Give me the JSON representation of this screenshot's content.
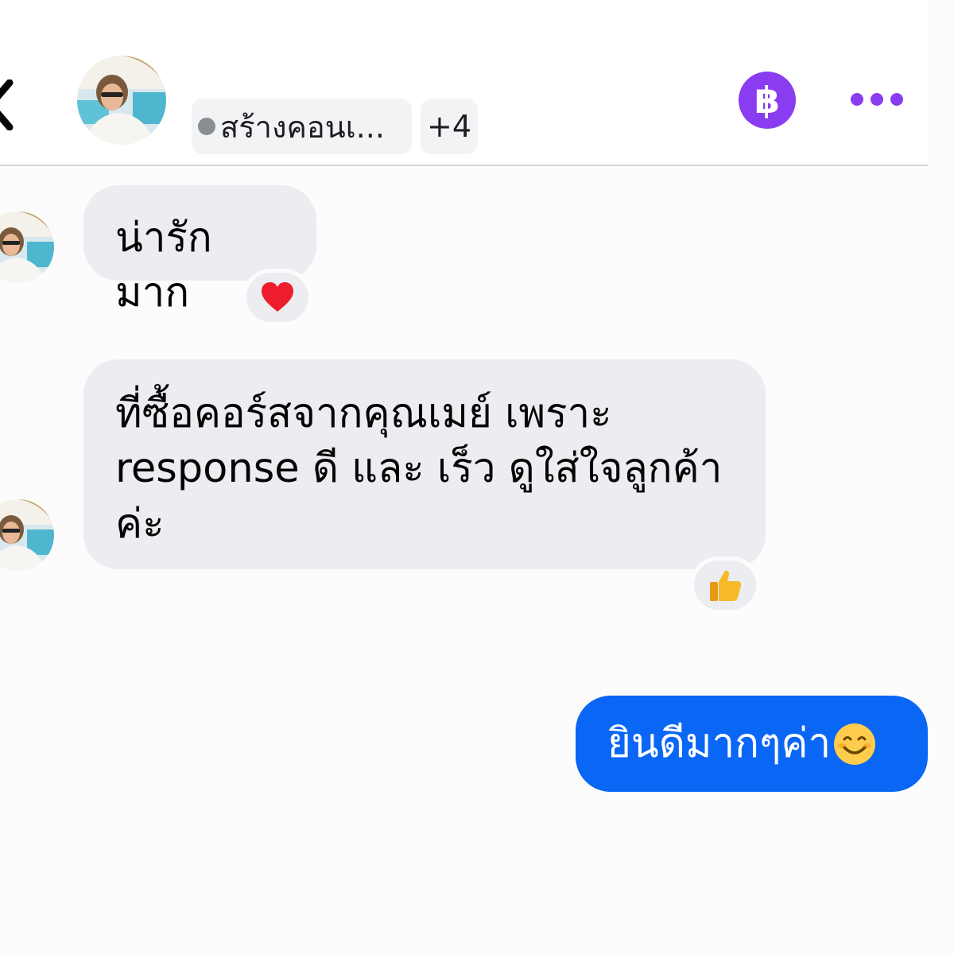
{
  "header": {
    "group_tag": "สร้างคอนเ...",
    "extra_count": "+4",
    "currency_symbol": "฿"
  },
  "messages": [
    {
      "sender": "other",
      "text": "น่ารักมาก",
      "reaction": "heart"
    },
    {
      "sender": "other",
      "text": "ที่ซื้อคอร์สจากคุณเมย์ เพราะ response ดี และ เร็ว ดูใส่ใจลูกค้าค่ะ",
      "reaction": "thumbs-up"
    },
    {
      "sender": "self",
      "text": "ยินดีมากๆค่า",
      "emoji": "smiling-face"
    }
  ],
  "colors": {
    "accent_purple": "#8a3df0",
    "outgoing_bubble": "#0a66f5",
    "incoming_bubble": "#ebedf0"
  }
}
